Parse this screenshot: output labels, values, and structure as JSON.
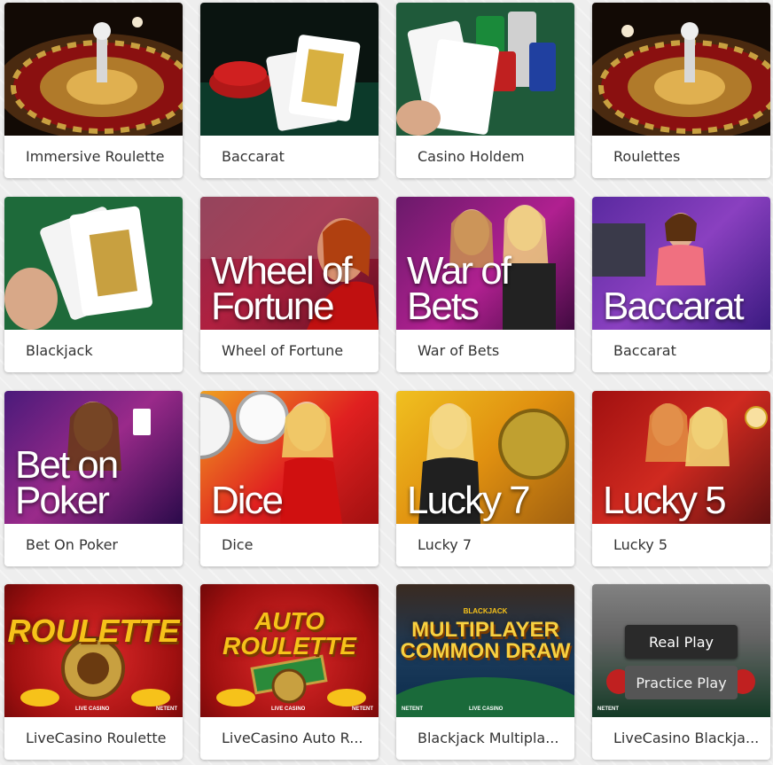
{
  "games": [
    {
      "title": "Immersive Roulette"
    },
    {
      "title": "Baccarat"
    },
    {
      "title": "Casino Holdem"
    },
    {
      "title": "Roulettes"
    },
    {
      "title": "Blackjack"
    },
    {
      "title": "Wheel of Fortune",
      "overlay": "Wheel of Fortune"
    },
    {
      "title": "War of Bets",
      "overlay": "War of Bets"
    },
    {
      "title": "Baccarat",
      "overlay": "Baccarat"
    },
    {
      "title": "Bet On Poker",
      "overlay": "Bet on Poker"
    },
    {
      "title": "Dice",
      "overlay": "Dice"
    },
    {
      "title": "Lucky 7",
      "overlay": "Lucky 7"
    },
    {
      "title": "Lucky 5",
      "overlay": "Lucky 5"
    },
    {
      "title": "LiveCasino Roulette",
      "logo": "ROULETTE",
      "brand": "LIVE CASINO",
      "provider": "NETENT"
    },
    {
      "title": "LiveCasino Auto R...",
      "logo": "AUTO ROULETTE",
      "brand": "LIVE CASINO",
      "provider": "NETENT"
    },
    {
      "title": "Blackjack Multipla...",
      "logo": "MULTIPLAYER COMMON DRAW",
      "logo_top": "BLACKJACK",
      "brand": "LIVE CASINO",
      "provider": "NETENT"
    },
    {
      "title": "LiveCasino Blackja...",
      "provider": "NETENT"
    }
  ],
  "hover_actions": {
    "real_play": "Real Play",
    "practice_play": "Practice Play"
  },
  "colors": {
    "background": "#eeeeee",
    "card": "#ffffff",
    "title_text": "#333333",
    "real_play_button": "#2a2a2a",
    "practice_play_button": "#555555"
  }
}
